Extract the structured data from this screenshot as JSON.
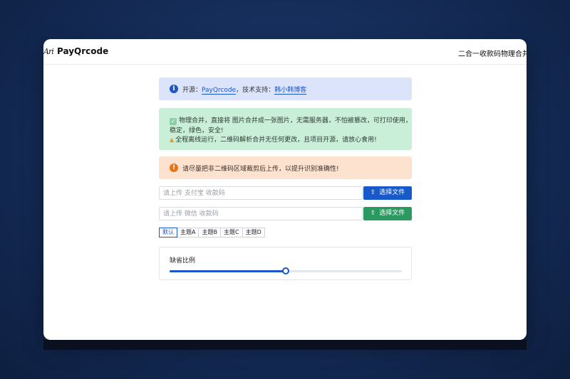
{
  "header": {
    "logo_text": "Ari",
    "brand": "PayQrcode",
    "tagline": "二合一收款码物理合并"
  },
  "alerts": {
    "info": {
      "prefix": "开源：",
      "link1": "PayQrcode",
      "middle": "，技术支持：",
      "link2": "韩小韩博客",
      "icon": "info-icon"
    },
    "success": {
      "line1": "物理合并，直接将 图片合并成一张图片，无需服务器，不怕被篡改，可打印使用，",
      "line2": "稳定，绿色，安全!",
      "line3": "全程离线运行，二维码解析合并无任何更改，且项目开源，请放心食用!"
    },
    "warning": {
      "icon_text": "!",
      "text": "请尽量把非二维码区域裁剪后上传，以提升识别准确性!"
    }
  },
  "uploads": [
    {
      "placeholder": "请上传 支付宝 收款码",
      "button_label": "选择文件",
      "color": "#1759c9"
    },
    {
      "placeholder": "请上传 微信 收款码",
      "button_label": "选择文件",
      "color": "#2a9a61"
    }
  ],
  "themes": {
    "selected": "默认",
    "tabs": [
      "默认",
      "主题A",
      "主题B",
      "主题C",
      "主题D"
    ]
  },
  "ratio": {
    "label": "缺省比例",
    "value_fraction": 0.5
  },
  "colors": {
    "primary": "#1a56c9",
    "success": "#2a9a61",
    "warning": "#e8741a"
  }
}
